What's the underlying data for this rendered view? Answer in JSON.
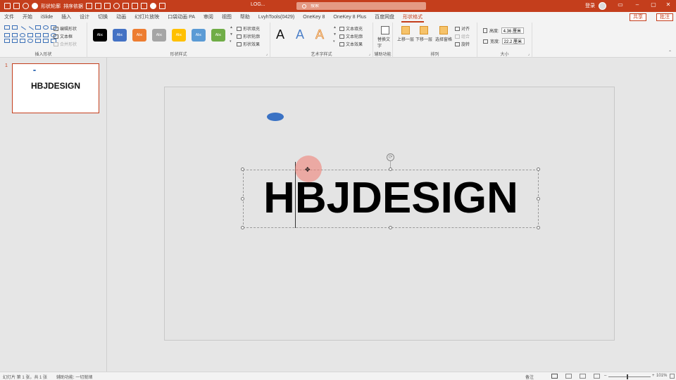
{
  "titlebar": {
    "qat_items": [
      "save-icon",
      "undo-icon",
      "redo-icon",
      "record-icon"
    ],
    "qat_label_1": "形状轮廓",
    "qat_label_2": "排序依据",
    "doc_title": "LOG... ",
    "search_placeholder": "搜索",
    "user_name": "登录",
    "min": "–",
    "restore": "▢",
    "close": "✕",
    "ribbon_toggle": "▭"
  },
  "tabs": [
    "文件",
    "开始",
    "iSlide",
    "插入",
    "设计",
    "切换",
    "动画",
    "幻灯片放映",
    "口袋动画 PA",
    "审阅",
    "视图",
    "帮助",
    "LvyhTools(0429)",
    "OneKey 8",
    "OneKey 8 Plus",
    "百度网盘",
    "形状格式"
  ],
  "active_tab": "形状格式",
  "share": "共享",
  "comment": "批注",
  "ribbon": {
    "insert_shapes": {
      "label": "插入形状",
      "edit_shape": "编辑形状",
      "text_box": "文本框",
      "merge_shapes": "合并形状"
    },
    "shape_styles": {
      "label": "形状样式",
      "swatch_text": "Abc",
      "swatch_colors": [
        "#000000",
        "#4472c4",
        "#ed7d31",
        "#a5a5a5",
        "#ffc000",
        "#5b9bd5",
        "#70ad47"
      ],
      "fill": "形状填充",
      "outline": "形状轮廓",
      "effects": "形状效果"
    },
    "wordart": {
      "label": "艺术字样式",
      "letters": [
        "A",
        "A",
        "A"
      ],
      "text_fill": "文本填充",
      "text_outline": "文本轮廓",
      "text_effects": "文本效果"
    },
    "accessibility": {
      "label": "辅助功能",
      "alt_text": "替换文字"
    },
    "arrange": {
      "label": "排列",
      "bring_forward": "上移一层",
      "send_backward": "下移一层",
      "selection_pane": "选择窗格",
      "align": "对齐",
      "group": "组合",
      "rotate": "旋转"
    },
    "size": {
      "label": "大小",
      "height_label": "高度:",
      "height": "4.36 厘米",
      "width_label": "宽度:",
      "width": "22.2 厘米"
    }
  },
  "thumbnail": {
    "number": "1",
    "text": "HBJDESIGN"
  },
  "slide": {
    "main_text": "HBJDESIGN"
  },
  "status": {
    "slide_info": "幻灯片 第 1 张，共 1 张",
    "accessibility": "辅助功能: 一切就绪",
    "notes": "备注",
    "zoom": "101%"
  },
  "colors": {
    "accent": "#c43e1c",
    "ellipse": "#3a72c4"
  }
}
